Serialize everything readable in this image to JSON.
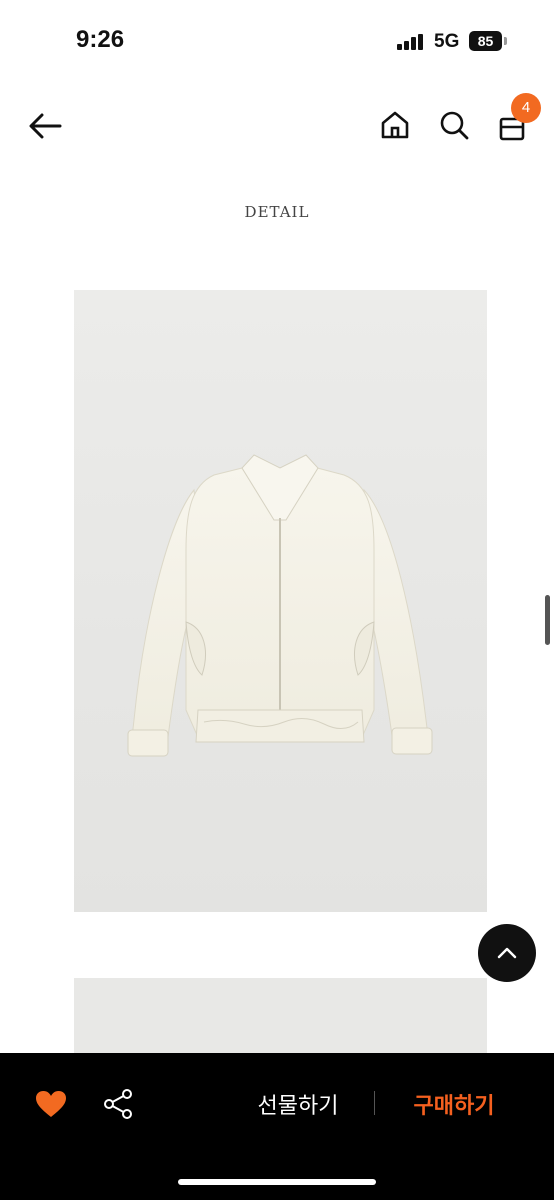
{
  "status_bar": {
    "time": "9:26",
    "network": "5G",
    "battery": "85"
  },
  "nav": {
    "cart_count": "4"
  },
  "section": {
    "title": "DETAIL"
  },
  "colors": {
    "accent": "#f26a21",
    "bar": "#000000",
    "buy": "#f5601f"
  },
  "icons": [
    "back-arrow-icon",
    "home-icon",
    "search-icon",
    "cart-icon",
    "heart-icon",
    "share-icon",
    "chevron-up-icon"
  ],
  "actions": {
    "gift_label": "선물하기",
    "buy_label": "구매하기"
  }
}
